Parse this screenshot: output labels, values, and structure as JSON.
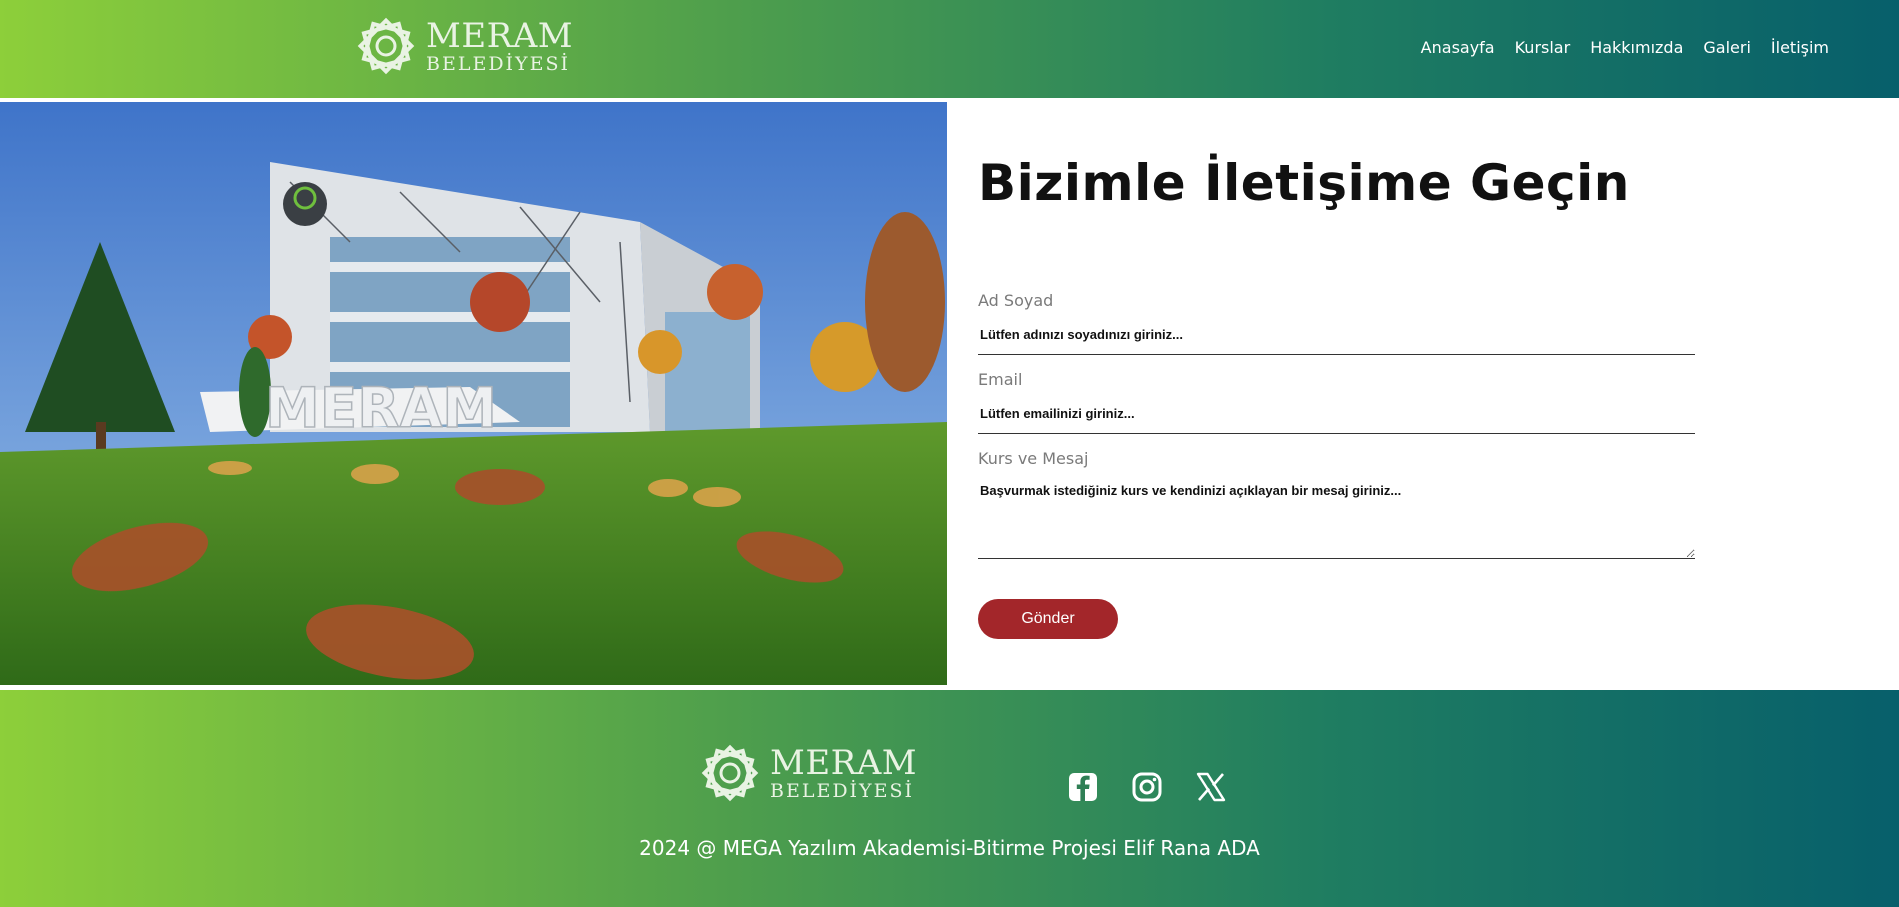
{
  "header": {
    "logo": {
      "line1": "MERAM",
      "line2": "BELEDİYESİ"
    },
    "nav": [
      {
        "label": "Anasayfa"
      },
      {
        "label": "Kurslar"
      },
      {
        "label": "Hakkımızda"
      },
      {
        "label": "Galeri"
      },
      {
        "label": "İletişim"
      }
    ]
  },
  "hero": {
    "sign_text": "MERAM",
    "building_logo": "MERAM"
  },
  "form": {
    "title": "Bizimle İletişime Geçin",
    "fields": [
      {
        "label": "Ad Soyad",
        "placeholder": "Lütfen adınızı soyadınızı giriniz..."
      },
      {
        "label": "Email",
        "placeholder": "Lütfen emailinizi giriniz..."
      },
      {
        "label": "Kurs ve Mesaj",
        "placeholder": "Başvurmak istediğiniz kurs ve kendinizi açıklayan bir mesaj giriniz..."
      }
    ],
    "submit_label": "Gönder"
  },
  "footer": {
    "logo": {
      "line1": "MERAM",
      "line2": "BELEDİYESİ"
    },
    "socials": [
      {
        "icon": "facebook-icon"
      },
      {
        "icon": "instagram-icon"
      },
      {
        "icon": "x-twitter-icon"
      }
    ],
    "copyright": "2024 @ MEGA Yazılım Akademisi-Bitirme Projesi Elif Rana ADA"
  },
  "colors": {
    "gradient_start": "#8dcf3a",
    "gradient_end": "#075f6b",
    "button": "#a3262a"
  }
}
